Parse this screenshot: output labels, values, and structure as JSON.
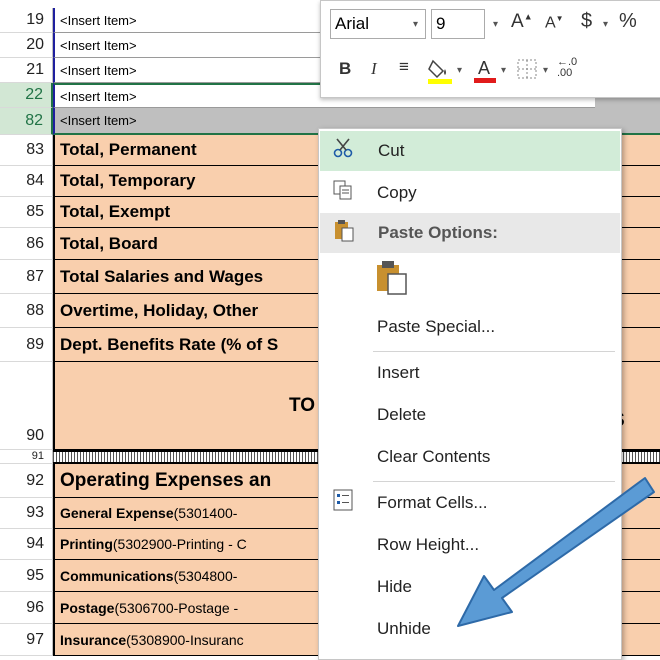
{
  "rows": [
    {
      "num": "19",
      "text": "<Insert Item>",
      "style": "item"
    },
    {
      "num": "20",
      "text": "<Insert Item>",
      "style": "item"
    },
    {
      "num": "21",
      "text": "<Insert Item>",
      "style": "item"
    },
    {
      "num": "22",
      "text": "<Insert Item>",
      "style": "item-sel"
    },
    {
      "num": "82",
      "text": "<Insert Item>",
      "style": "item-gray"
    },
    {
      "num": "83",
      "text": "Total, Permanent",
      "style": "peach"
    },
    {
      "num": "84",
      "text": "Total, Temporary",
      "style": "peach"
    },
    {
      "num": "85",
      "text": "Total, Exempt",
      "style": "peach"
    },
    {
      "num": "86",
      "text": "Total, Board",
      "style": "peach"
    },
    {
      "num": "87",
      "text": "Total Salaries and Wages",
      "style": "peach"
    },
    {
      "num": "88",
      "text": "Overtime, Holiday, Other",
      "style": "peach"
    },
    {
      "num": "89",
      "text": "Dept. Benefits Rate (% of S",
      "style": "peach"
    },
    {
      "num": "90",
      "text": "TO",
      "style": "tall"
    },
    {
      "num": "91",
      "text": "",
      "style": "hatch"
    },
    {
      "num": "92",
      "text": "Operating Expenses an",
      "style": "peach-big"
    },
    {
      "num": "93",
      "bold": "General Expense",
      "rest": " (5301400-",
      "style": "small"
    },
    {
      "num": "94",
      "bold": "Printing",
      "rest": " (5302900-Printing - C",
      "style": "small"
    },
    {
      "num": "95",
      "bold": "Communications",
      "rest": " (5304800-",
      "style": "small"
    },
    {
      "num": "96",
      "bold": "Postage",
      "rest": " (5306700-Postage - ",
      "style": "small"
    },
    {
      "num": "97",
      "bold": "Insurance",
      "rest": " (5308900-Insuranc",
      "style": "small"
    }
  ],
  "toolbar": {
    "font": "Arial",
    "size": "9",
    "bold": "B",
    "italic": "I",
    "dollar": "$"
  },
  "menu": {
    "cut": "Cut",
    "copy": "Copy",
    "paste_options": "Paste Options:",
    "paste_special": "Paste Special...",
    "insert": "Insert",
    "delete": "Delete",
    "clear_contents": "Clear Contents",
    "format_cells": "Format Cells...",
    "row_height": "Row Height...",
    "hide": "Hide",
    "unhide": "Unhide"
  },
  "annotation": {
    "arrow_color": "#5b9bd5"
  },
  "colors": {
    "peach": "#f9cfad",
    "highlight": "#d2ecd8",
    "selection": "#217346"
  }
}
